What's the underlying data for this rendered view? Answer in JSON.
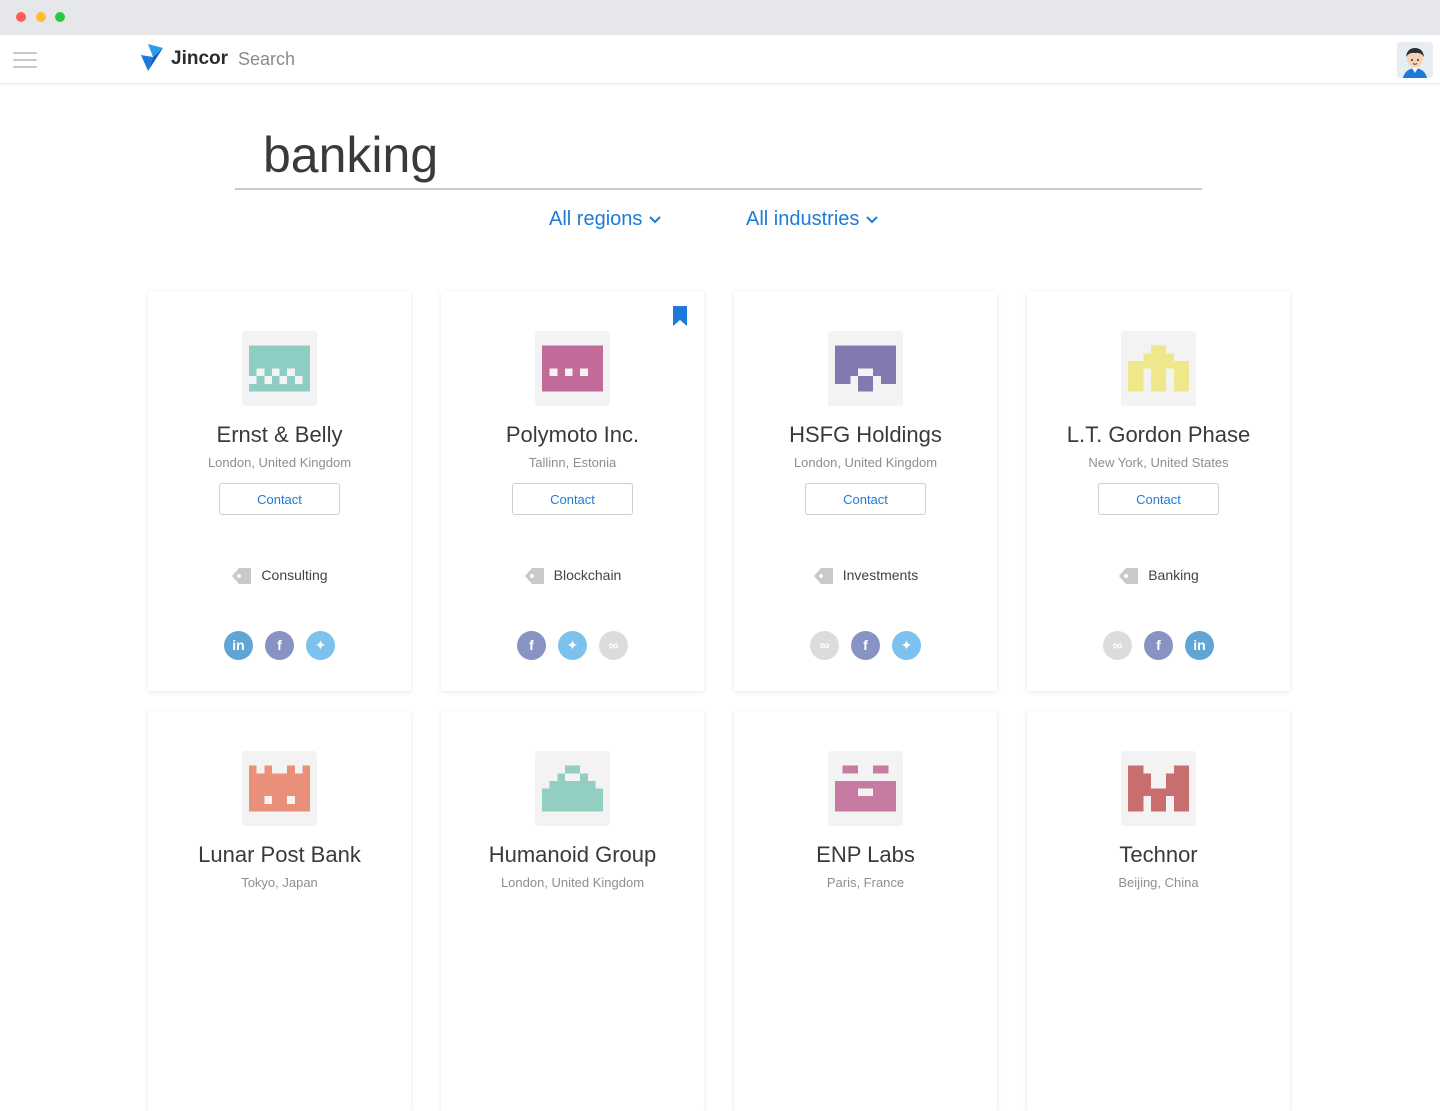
{
  "window": {
    "controls": [
      "close",
      "minimize",
      "maximize"
    ]
  },
  "header": {
    "brand": "Jincor",
    "section": "Search",
    "avatar_icon": "user-avatar-icon"
  },
  "search": {
    "query": "banking"
  },
  "filters": {
    "regions": "All regions",
    "industries": "All industries"
  },
  "colors": {
    "accent": "#1e7ad8"
  },
  "cards": [
    {
      "name": "Ernst & Belly",
      "location": "London, United Kingdom",
      "contact": "Contact",
      "tag": "Consulting",
      "logo_color": "#8ecdc3",
      "bookmarked": false,
      "socials": [
        "linkedin",
        "facebook",
        "twitter"
      ]
    },
    {
      "name": "Polymoto Inc.",
      "location": "Tallinn, Estonia",
      "contact": "Contact",
      "tag": "Blockchain",
      "logo_color": "#c26a99",
      "bookmarked": true,
      "socials": [
        "facebook",
        "twitter",
        "link"
      ]
    },
    {
      "name": "HSFG Holdings",
      "location": "London, United Kingdom",
      "contact": "Contact",
      "tag": "Investments",
      "logo_color": "#8179b0",
      "bookmarked": false,
      "socials": [
        "link",
        "facebook",
        "twitter"
      ]
    },
    {
      "name": "L.T. Gordon Phase",
      "location": "New York, United States",
      "contact": "Contact",
      "tag": "Banking",
      "logo_color": "#eee88a",
      "bookmarked": false,
      "socials": [
        "link",
        "facebook",
        "linkedin"
      ]
    },
    {
      "name": "Lunar Post Bank",
      "location": "Tokyo, Japan",
      "logo_color": "#e8907a"
    },
    {
      "name": "Humanoid Group",
      "location": "London, United Kingdom",
      "logo_color": "#92cfc2"
    },
    {
      "name": "ENP Labs",
      "location": "Paris, France",
      "logo_color": "#c77ba3"
    },
    {
      "name": "Technor",
      "location": "Beijing, China",
      "logo_color": "#c96e6e"
    }
  ]
}
